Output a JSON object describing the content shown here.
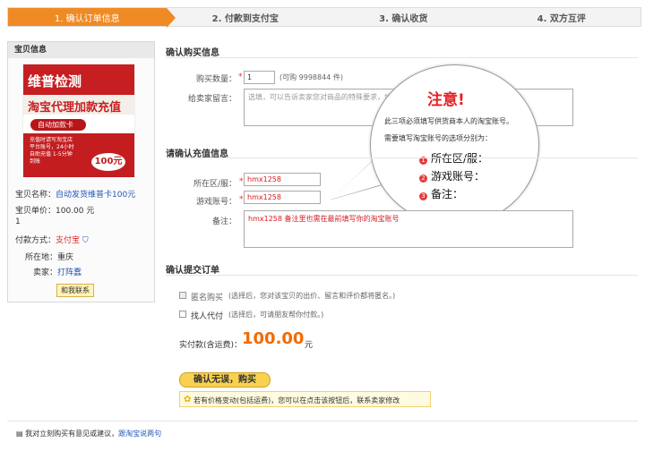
{
  "steps": [
    "1. 确认订单信息",
    "2. 付款到支付宝",
    "3. 确认收货",
    "4. 双方互评"
  ],
  "sidebar": {
    "title": "宝贝信息",
    "promo": {
      "line1": "维普检测",
      "line2": "淘宝代理加款充值",
      "pill": "自动加款卡",
      "body": "充值时请写淘宝店\n平台账号，24小时\n自助充值 1-5分钟\n到账",
      "price": "100元"
    },
    "name_label": "宝贝名称：",
    "name_value": "自动发货维普卡100元",
    "price_label": "宝贝单价：",
    "price_value": "100.00 元",
    "qty": "1",
    "pay_label": "付款方式：",
    "pay_value": "支付宝",
    "location_label": "所在地：",
    "location_value": "重庆",
    "seller_label": "卖家：",
    "seller_value": "打阵蠢",
    "contact": "和我联系"
  },
  "confirm_buy": {
    "title": "确认购买信息",
    "qty_label": "购买数量：",
    "qty_value": "1",
    "qty_note": "(可购 9998844 件)",
    "msg_label": "给卖家留言：",
    "msg_value": "选填，可以告诉卖家您对商品的特殊要求，如："
  },
  "balloon": {
    "title": "注意!",
    "line1": "此三项必须填写供货商本人的淘宝账号。",
    "line2": "需要填写淘宝账号的选项分别为：",
    "items": [
      "所在区/服：",
      "游戏账号：",
      "备注："
    ]
  },
  "recharge": {
    "title": "请确认充值信息",
    "region_label": "所在区/服：",
    "region_value": "hmx1258",
    "account_label": "游戏账号：",
    "account_value": "hmx1258",
    "note_label": "备注：",
    "note_value": "hmx1258  备注里也需在最前填写你的淘宝账号"
  },
  "submit": {
    "title": "确认提交订单",
    "anon_label": "匿名购买",
    "anon_note": "(选择后，您对该宝贝的出价、留言和评价都将匿名。)",
    "proxy_label": "找人代付",
    "proxy_note": "(选择后，可请朋友帮你付款。)",
    "total_label": "实付款(含运费)：",
    "total_value": "100.00",
    "total_unit": "元",
    "button": "确认无误，购买",
    "notice": "若有价格变动(包括运费)，您可以在点击该按钮后，联系卖家修改"
  },
  "feedback": {
    "text": "我对立刻购买有意见或建议，",
    "link": "跟淘宝说两句"
  }
}
